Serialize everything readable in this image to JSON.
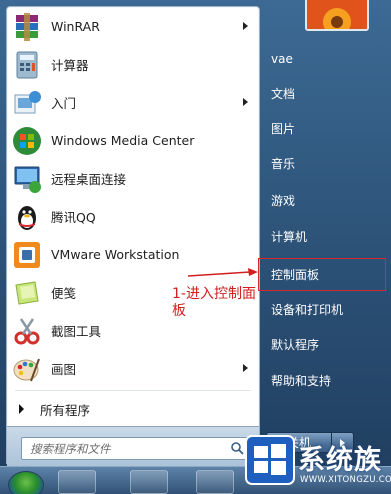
{
  "programs": [
    {
      "label": "WinRAR",
      "icon": "winrar-icon",
      "has_submenu": true
    },
    {
      "label": "计算器",
      "icon": "calculator-icon",
      "has_submenu": false
    },
    {
      "label": "入门",
      "icon": "getting-started-icon",
      "has_submenu": true
    },
    {
      "label": "Windows Media Center",
      "icon": "media-center-icon",
      "has_submenu": false
    },
    {
      "label": "远程桌面连接",
      "icon": "remote-desktop-icon",
      "has_submenu": false
    },
    {
      "label": "腾讯QQ",
      "icon": "qq-penguin-icon",
      "has_submenu": false
    },
    {
      "label": "VMware Workstation",
      "icon": "vmware-icon",
      "has_submenu": false
    },
    {
      "label": "便笺",
      "icon": "sticky-notes-icon",
      "has_submenu": false
    },
    {
      "label": "截图工具",
      "icon": "snipping-tool-icon",
      "has_submenu": false
    },
    {
      "label": "画图",
      "icon": "paint-icon",
      "has_submenu": true
    }
  ],
  "all_programs": "所有程序",
  "search": {
    "placeholder": "搜索程序和文件"
  },
  "right_pane": {
    "items": [
      {
        "label": "vae"
      },
      {
        "label": "文档"
      },
      {
        "label": "图片"
      },
      {
        "label": "音乐"
      },
      {
        "label": "游戏"
      },
      {
        "label": "计算机"
      },
      {
        "label": "控制面板"
      },
      {
        "label": "设备和打印机"
      },
      {
        "label": "默认程序"
      },
      {
        "label": "帮助和支持"
      }
    ]
  },
  "shutdown": {
    "label": "关机"
  },
  "annotation": {
    "text": "1-进入控制面板",
    "color": "#d11f1f"
  },
  "watermark": {
    "text": "系统族",
    "url": "WWW.XITONGZU.COM"
  },
  "colors": {
    "highlight": "#d12b2b",
    "accent": "#2b5075"
  }
}
